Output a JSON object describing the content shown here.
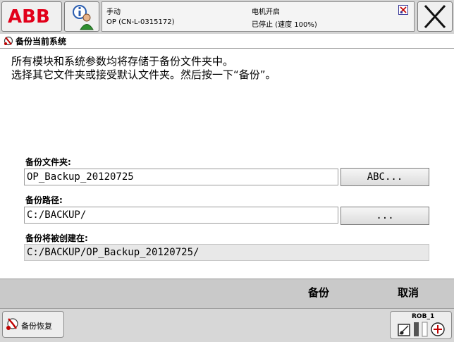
{
  "header": {
    "logo": "ABB",
    "mode": "手动",
    "controller": "OP (CN-L-0315172)",
    "motor_state": "电机开启",
    "run_state": "已停止 (速度 100%)"
  },
  "title": "备份当前系统",
  "description": {
    "line1": "所有模块和系统参数均将存储于备份文件夹中。",
    "line2": "选择其它文件夹或接受默认文件夹。然后按一下“备份”。"
  },
  "backup_folder": {
    "label": "备份文件夹:",
    "value": "OP_Backup_20120725",
    "button": "ABC..."
  },
  "backup_path": {
    "label": "备份路径:",
    "value": "C:/BACKUP/",
    "button": "..."
  },
  "created_at": {
    "label": "备份将被创建在:",
    "value": "C:/BACKUP/OP_Backup_20120725/"
  },
  "commands": {
    "backup": "备份",
    "cancel": "取消"
  },
  "taskbar": {
    "app": "备份恢复",
    "robot": "ROB_1"
  },
  "colors": {
    "abb_red": "#e2001a",
    "background": "#ffffff",
    "bar_gray": "#c9c9c9"
  }
}
